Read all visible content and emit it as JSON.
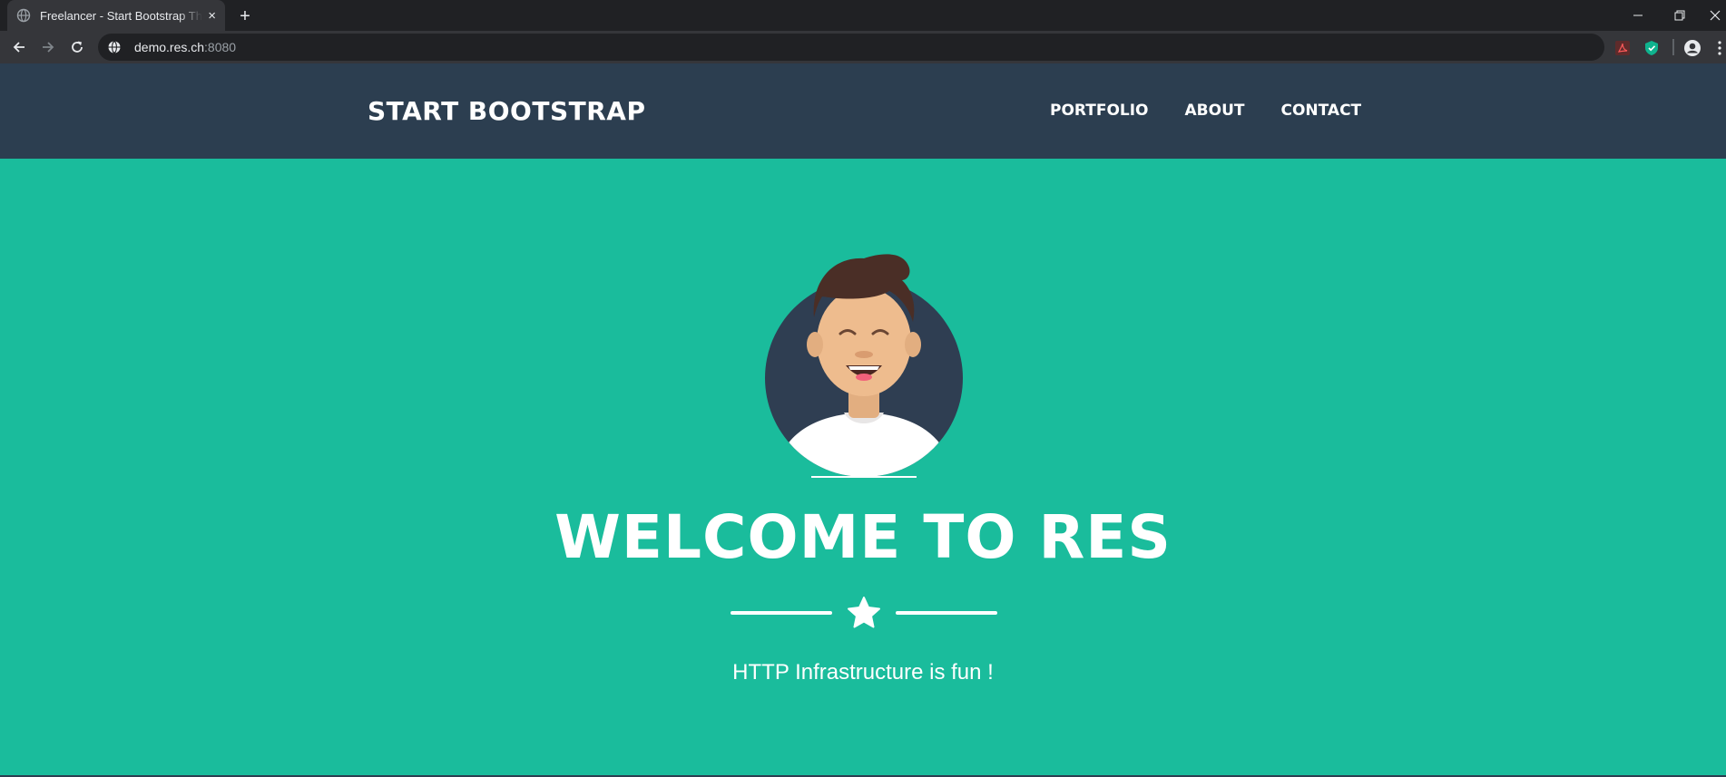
{
  "browser": {
    "tab_title": "Freelancer - Start Bootstrap Theme",
    "tab_close": "×",
    "new_tab": "+",
    "url_host": "demo.res.ch",
    "url_port": ":8080"
  },
  "navbar": {
    "brand": "START BOOTSTRAP",
    "links": [
      "PORTFOLIO",
      "ABOUT",
      "CONTACT"
    ]
  },
  "masthead": {
    "title": "WELCOME TO RES",
    "subtitle": "HTTP Infrastructure is fun !"
  },
  "colors": {
    "primary_dark": "#2c3e50",
    "accent_teal": "#1abc9c",
    "text_white": "#ffffff"
  }
}
